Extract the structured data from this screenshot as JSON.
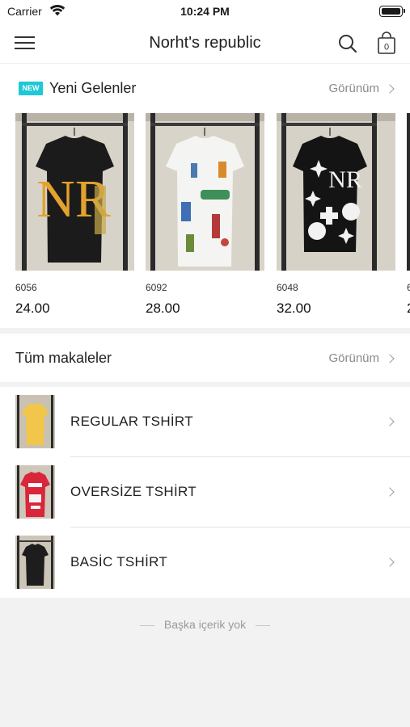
{
  "status_bar": {
    "carrier": "Carrier",
    "time": "10:24 PM"
  },
  "nav": {
    "title": "Norht's republic",
    "cart_count": "0"
  },
  "new_arrivals": {
    "badge": "NEW",
    "title": "Yeni Gelenler",
    "see_all": "Görünüm",
    "products": [
      {
        "code": "6056",
        "price": "24.00"
      },
      {
        "code": "6092",
        "price": "28.00"
      },
      {
        "code": "6048",
        "price": "32.00"
      },
      {
        "code": "6",
        "price": "2"
      }
    ]
  },
  "all_articles": {
    "title": "Tüm makaleler",
    "see_all": "Görünüm"
  },
  "categories": [
    {
      "label": "REGULAR TSHİRT"
    },
    {
      "label": "OVERSİZE TSHİRT"
    },
    {
      "label": "BASİC TSHİRT"
    }
  ],
  "footer": {
    "note": "Başka içerik yok"
  },
  "colors": {
    "accent": "#1ec8d6",
    "background": "#f2f2f2",
    "muted_text": "#8a8a8a"
  }
}
